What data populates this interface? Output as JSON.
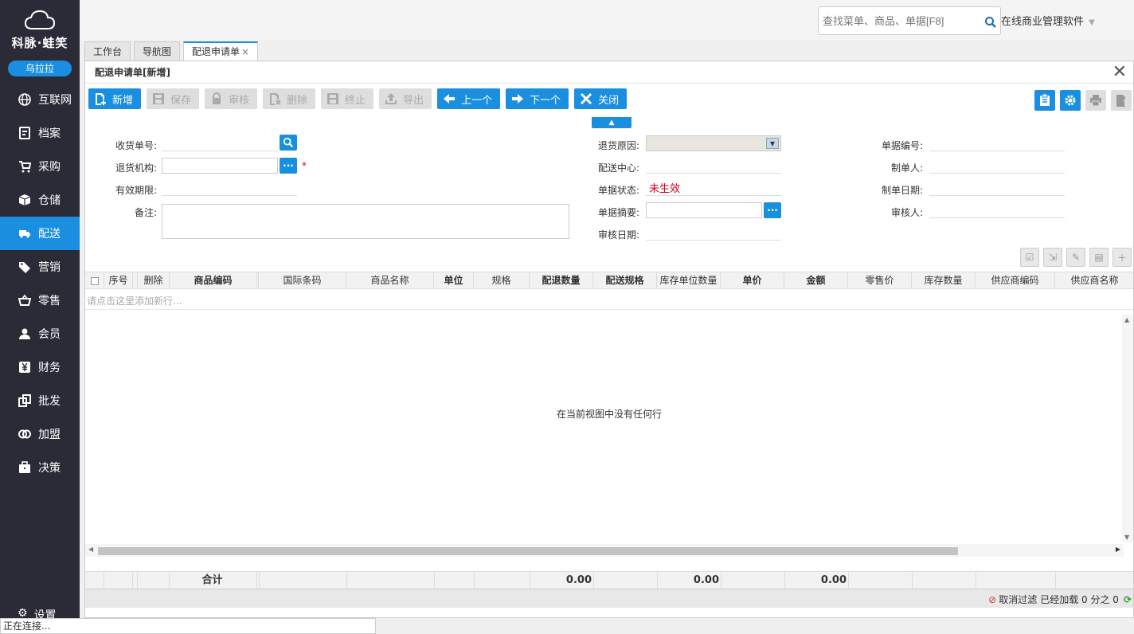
{
  "brand": "科脉·蛙笑",
  "user": "乌拉拉",
  "nav": [
    {
      "label": "互联网",
      "icon": "globe-icon"
    },
    {
      "label": "档案",
      "icon": "document-icon"
    },
    {
      "label": "采购",
      "icon": "cart-icon"
    },
    {
      "label": "仓储",
      "icon": "box-icon"
    },
    {
      "label": "配送",
      "icon": "truck-icon"
    },
    {
      "label": "营销",
      "icon": "tag-icon"
    },
    {
      "label": "零售",
      "icon": "basket-icon"
    },
    {
      "label": "会员",
      "icon": "user-icon"
    },
    {
      "label": "财务",
      "icon": "yen-icon"
    },
    {
      "label": "批发",
      "icon": "copy-icon"
    },
    {
      "label": "加盟",
      "icon": "rings-icon"
    },
    {
      "label": "决策",
      "icon": "briefcase-icon"
    }
  ],
  "nav_settings": "设置",
  "search": {
    "placeholder": "查找菜单、商品、单据[F8]"
  },
  "app_title": "在线商业管理软件",
  "tabs": [
    {
      "label": "工作台"
    },
    {
      "label": "导航图"
    },
    {
      "label": "配退申请单",
      "close": "×"
    }
  ],
  "form_title": "配退申请单[新增]",
  "toolbar": {
    "new": "新增",
    "save": "保存",
    "audit": "审核",
    "delete": "删除",
    "terminate": "终止",
    "export": "导出",
    "prev": "上一个",
    "next": "下一个",
    "close": "关闭"
  },
  "fields": {
    "receipt_no": "收货单号:",
    "return_org": "退货机构:",
    "valid_period": "有效期限:",
    "remark": "备注:",
    "return_reason": "退货原因:",
    "dist_center": "配送中心:",
    "doc_status": "单据状态:",
    "doc_status_value": "未生效",
    "doc_summary": "单据摘要:",
    "audit_date": "审核日期:",
    "doc_no": "单据编号:",
    "creator": "制单人:",
    "create_date": "制单日期:",
    "auditor": "审核人:",
    "required_mark": "*"
  },
  "grid": {
    "columns": [
      "序号",
      "删除",
      "商品编码",
      "国际条码",
      "商品名称",
      "单位",
      "规格",
      "配退数量",
      "配送规格",
      "库存单位数量",
      "单价",
      "金额",
      "零售价",
      "库存数量",
      "供应商编码",
      "供应商名称"
    ],
    "add_row_hint": "请点击这里添加新行...",
    "empty_message": "在当前视图中没有任何行",
    "footer_label": "合计",
    "totals": {
      "qty": "0.00",
      "unit_qty": "0.00",
      "amount": "0.00"
    }
  },
  "status": {
    "cancel_filter": "取消过滤",
    "loaded": "已经加载 0 分之 0"
  },
  "browser_status": "正在连接..."
}
